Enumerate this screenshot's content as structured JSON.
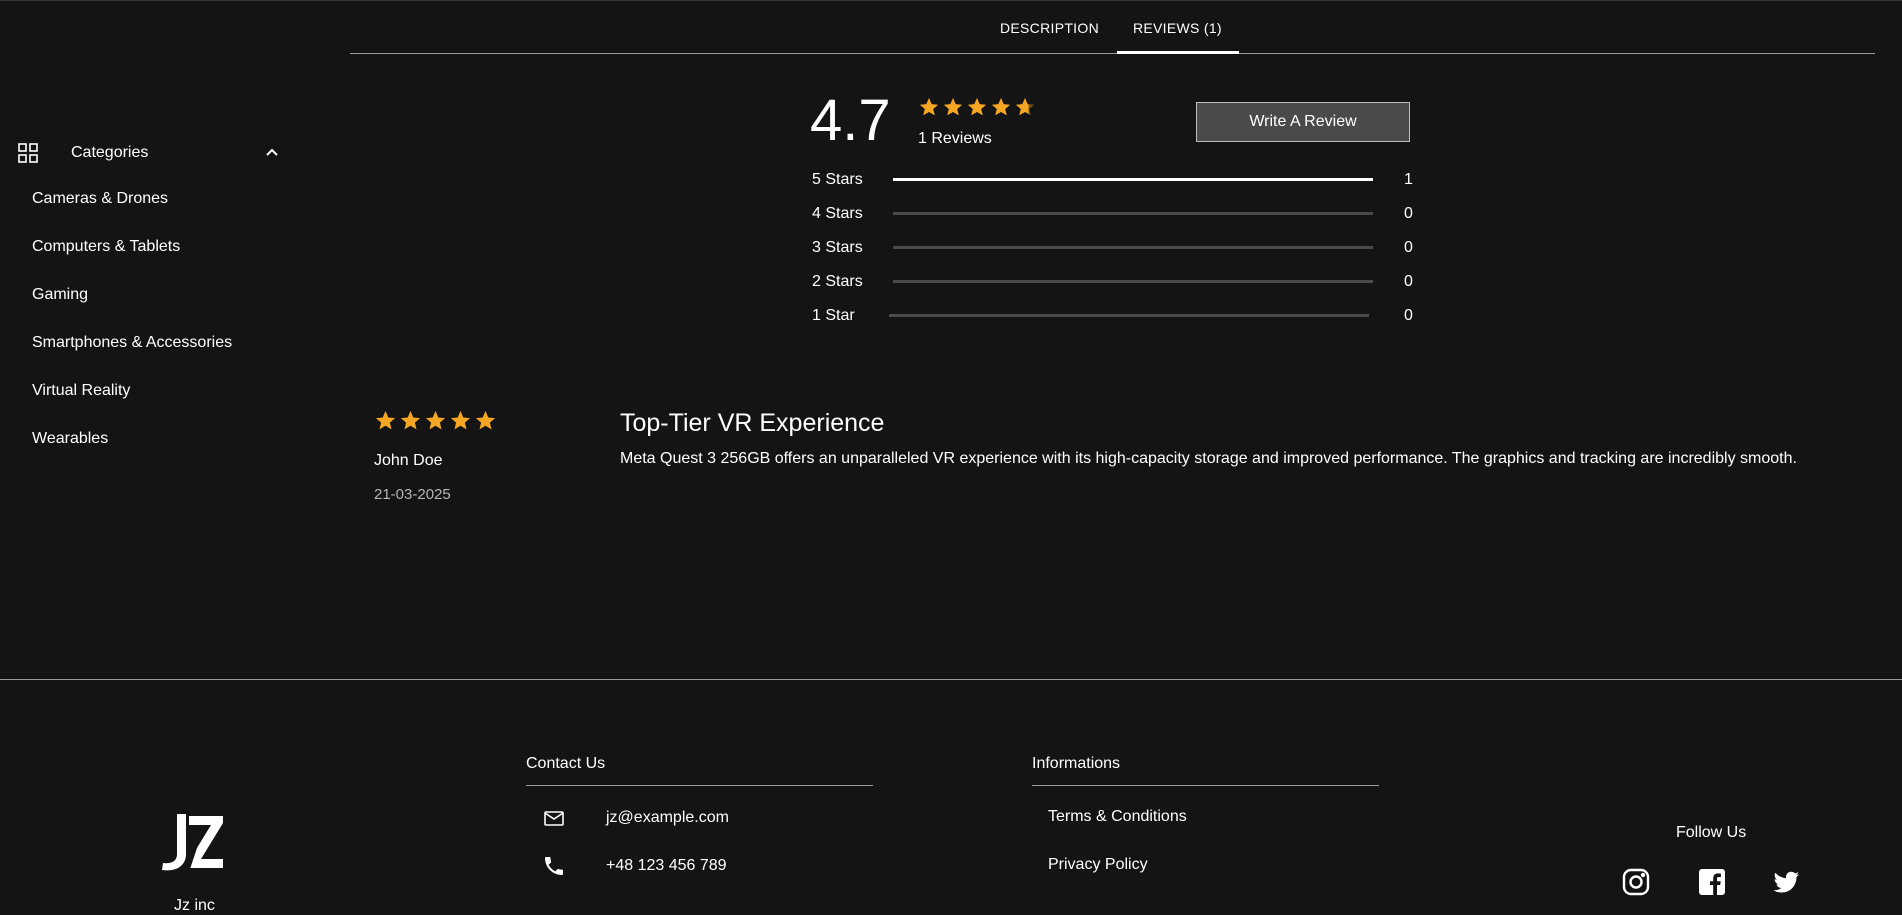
{
  "tabs": [
    {
      "label": "DESCRIPTION"
    },
    {
      "label": "REVIEWS (1)"
    }
  ],
  "sidebar": {
    "header": "Categories",
    "items": [
      {
        "label": "Cameras & Drones"
      },
      {
        "label": "Computers & Tablets"
      },
      {
        "label": "Gaming"
      },
      {
        "label": "Smartphones & Accessories"
      },
      {
        "label": "Virtual Reality"
      },
      {
        "label": "Wearables"
      }
    ]
  },
  "rating_summary": {
    "average": "4.7",
    "stars_shown": 4.7,
    "count_label": "1 Reviews",
    "write_button": "Write A Review",
    "distribution": [
      {
        "label": "5 Stars",
        "count": "1",
        "fraction": 1
      },
      {
        "label": "4 Stars",
        "count": "0",
        "fraction": 0
      },
      {
        "label": "3 Stars",
        "count": "0",
        "fraction": 0
      },
      {
        "label": "2 Stars",
        "count": "0",
        "fraction": 0
      },
      {
        "label": "1 Star",
        "count": "0",
        "fraction": 0
      }
    ]
  },
  "review": {
    "stars": 5,
    "author": "John Doe",
    "date": "21-03-2025",
    "title": "Top-Tier VR Experience",
    "body": "Meta Quest 3 256GB offers an unparalleled VR experience with its high-capacity storage and improved performance. The graphics and tracking are incredibly smooth."
  },
  "footer": {
    "company": "Jz inc",
    "contact": {
      "title": "Contact Us",
      "email": "jz@example.com",
      "phone": "+48 123 456 789"
    },
    "informations": {
      "title": "Informations",
      "links": [
        {
          "label": "Terms & Conditions"
        },
        {
          "label": "Privacy Policy"
        }
      ]
    },
    "follow": {
      "title": "Follow Us",
      "networks": [
        "instagram-icon",
        "facebook-icon",
        "twitter-icon"
      ]
    }
  },
  "colors": {
    "background": "#141414",
    "star": "#f5a623",
    "text": "#ffffff",
    "muted": "#b5b5b5"
  }
}
